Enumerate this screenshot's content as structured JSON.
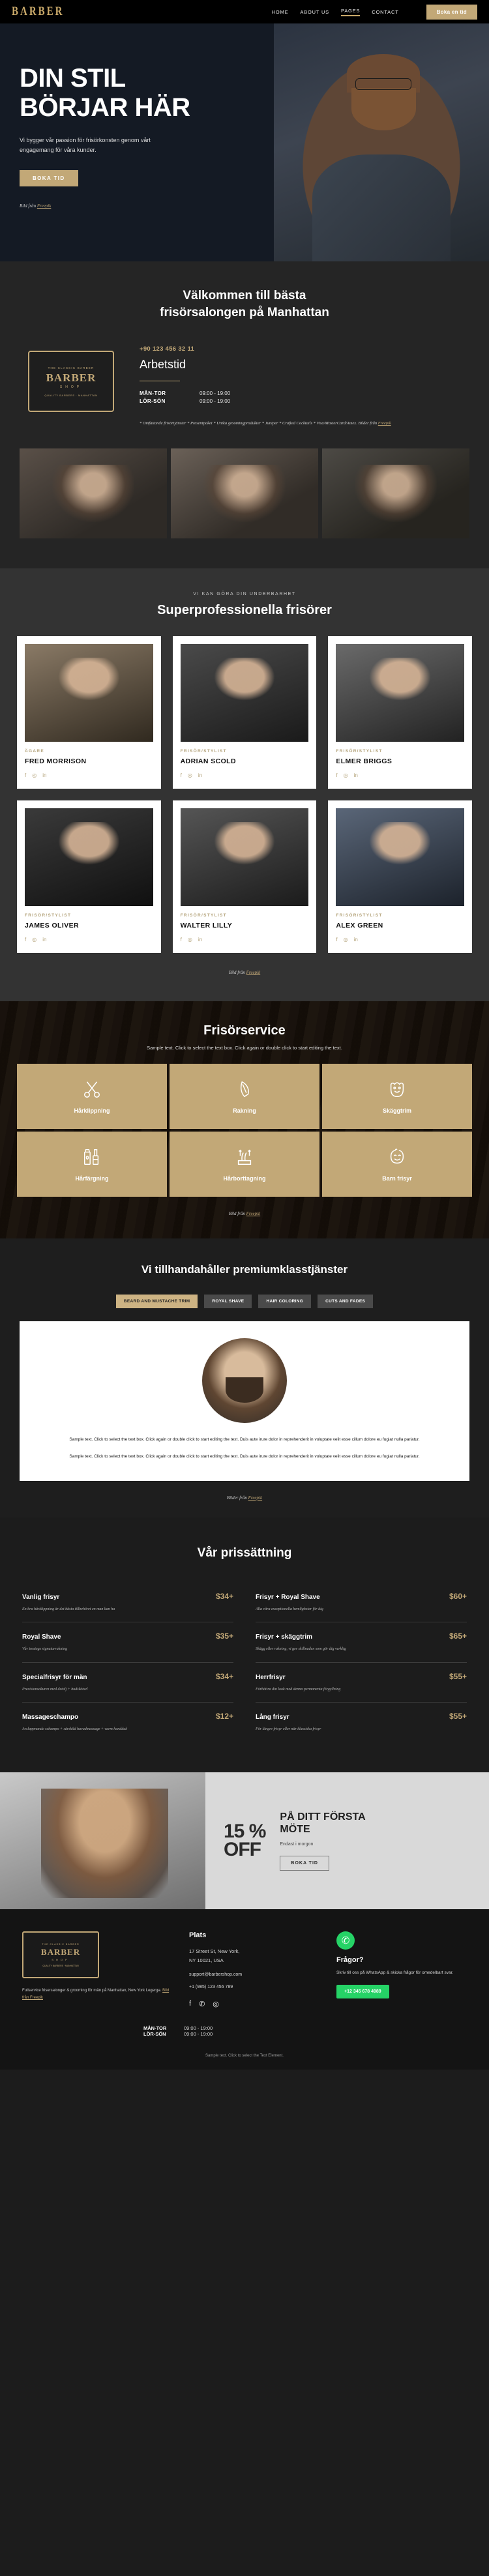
{
  "header": {
    "logo": "BARBER",
    "nav": [
      {
        "label": "HOME",
        "active": false
      },
      {
        "label": "ABOUT US",
        "active": false
      },
      {
        "label": "PAGES",
        "active": true
      },
      {
        "label": "CONTACT",
        "active": false
      }
    ],
    "cta": "Boka en tid"
  },
  "hero": {
    "title_line1": "DIN STIL",
    "title_line2": "BÖRJAR HÄR",
    "subtitle": "Vi bygger vår passion för frisörkonsten genom vårt engagemang för våra kunder.",
    "button": "BOKA TID",
    "credit_prefix": "Bild från ",
    "credit_link": "Freepik"
  },
  "welcome": {
    "title_line1": "Välkommen till bästa",
    "title_line2": "frisörsalongen på Manhattan",
    "badge": {
      "top": "THE CLASSIC BARBER",
      "main": "BARBER",
      "shop": "SHOP",
      "bottom": "QUALITY BARBERS · MANHATTAN"
    },
    "phone": "+90 123 456 32 11",
    "hours_title": "Arbetstid",
    "hours": [
      {
        "days": "MÅN-TOR",
        "time": "09:00 - 19:00"
      },
      {
        "days": "LÖR-SÖN",
        "time": "09:00 - 19:00"
      }
    ],
    "note": "* Omfattande frisörtjänster * Presentpaket * Unika groomingprodukter * Juniper * Crafted Cocktails *  Visa/MasterCard/Amex. Bilder från ",
    "note_link": "Freepik"
  },
  "team": {
    "eyebrow": "VI KAN GÖRA DIN UNDERBARHET",
    "title": "Superprofessionella frisörer",
    "members": [
      {
        "role": "ÄGARE",
        "name": "FRED MORRISON"
      },
      {
        "role": "FRISÖR/STYLIST",
        "name": "ADRIAN SCOLD"
      },
      {
        "role": "FRISÖR/STYLIST",
        "name": "ELMER BRIGGS"
      },
      {
        "role": "FRISÖR/STYLIST",
        "name": "JAMES OLIVER"
      },
      {
        "role": "FRISÖR/STYLIST",
        "name": "WALTER LILLY"
      },
      {
        "role": "FRISÖR/STYLIST",
        "name": "ALEX GREEN"
      }
    ],
    "social": [
      "f",
      "◎",
      "in"
    ],
    "credit_prefix": "Bild från ",
    "credit_link": "Freepik"
  },
  "services": {
    "title": "Frisörservice",
    "subtitle": "Sample text. Click to select the text box. Click again or double click to start editing the text.",
    "items": [
      {
        "label": "Hårklippning",
        "icon": "scissors-icon"
      },
      {
        "label": "Rakning",
        "icon": "razor-icon"
      },
      {
        "label": "Skäggtrim",
        "icon": "beard-icon"
      },
      {
        "label": "Hårfärgning",
        "icon": "hair-dye-icon"
      },
      {
        "label": "Hårborttagning",
        "icon": "hair-removal-icon"
      },
      {
        "label": "Barn frisyr",
        "icon": "child-face-icon"
      }
    ],
    "credit_prefix": "Bild från ",
    "credit_link": "Freepik"
  },
  "premium": {
    "title": "Vi tillhandahåller premiumklasstjänster",
    "tabs": [
      {
        "label": "BEARD AND MUSTACHE TRIM",
        "active": true
      },
      {
        "label": "ROYAL SHAVE",
        "active": false
      },
      {
        "label": "HAIR COLORING",
        "active": false
      },
      {
        "label": "CUTS AND FADES",
        "active": false
      }
    ],
    "body1": "Sample text. Click to select the text box. Click again or double click to start editing the text. Duis aute irure dolor in reprehenderit in voluptate velit esse cillum dolore eu fugiat nulla pariatur.",
    "body2": "Sample text. Click to select the text box. Click again or double click to start editing the text. Duis aute irure dolor in reprehenderit in voluptate velit esse cillum dolore eu fugiat nulla pariatur.",
    "credit_prefix": "Bilder från ",
    "credit_link": "Freepik"
  },
  "pricing": {
    "title": "Vår prissättning",
    "items": [
      {
        "name": "Vanlig frisyr",
        "price": "$34+",
        "desc": "En bra hårklippning är det bästa tillbehöret en man kan ha"
      },
      {
        "name": "Frisyr + Royal Shave",
        "price": "$60+",
        "desc": "Alla våra exceptionella hemligheter för dig"
      },
      {
        "name": "Royal Shave",
        "price": "$35+",
        "desc": "Vår trestegs signaturrakning"
      },
      {
        "name": "Frisyr + skäggtrim",
        "price": "$65+",
        "desc": "Skägg eller rakning, vi ger skillnaden som gör dig verklig"
      },
      {
        "name": "Specialfrisyr för män",
        "price": "$34+",
        "desc": "Precisionsakuren med detalj + hudskötsel"
      },
      {
        "name": "Herrfrisyr",
        "price": "$55+",
        "desc": "Förbättra din look med denna permanenta förgyllning"
      },
      {
        "name": "Massageschampo",
        "price": "$12+",
        "desc": "Avslappnande schampo + särskild huvudmassage + varm handduk"
      },
      {
        "name": "Lång frisyr",
        "price": "$55+",
        "desc": "För längre frisyr eller när klassiska frisyr"
      }
    ]
  },
  "promo": {
    "percent": "15 %",
    "off": "OFF",
    "title_line1": "PÅ DITT FÖRSTA",
    "title_line2": "MÖTE",
    "subtitle": "Endast i morgon",
    "button": "BOKA TID"
  },
  "footer": {
    "logo": {
      "top": "THE CLASSIC BARBER",
      "main": "BARBER",
      "shop": "SHOP",
      "bottom": "QUALITY BARBERS · MANHATTAN"
    },
    "about": "Fullservice frisersalonger & grooming för män på Manhattan, New York Legerga. ",
    "about_link": "Bild från Freepik",
    "place_title": "Plats",
    "address_line1": "17 Street St, New York,",
    "address_line2": "NY 10021, USA",
    "email_label": "support@barbershop.com",
    "phone": "+1 (985) 123 456 789",
    "social": [
      "f",
      "✆",
      "◎"
    ],
    "question_title": "Frågor?",
    "question_text": "Skriv till oss på WhatsApp & skicka frågor för omedelbart svar.",
    "whatsapp_button": "+12 345 678 4989",
    "hours": [
      {
        "days": "MÅN-TOR",
        "time": "09:00 - 19:00"
      },
      {
        "days": "LÖR-SÖN",
        "time": "09:00 - 19:00"
      }
    ],
    "bottom": "Sample text. Click to select the Text Element."
  }
}
